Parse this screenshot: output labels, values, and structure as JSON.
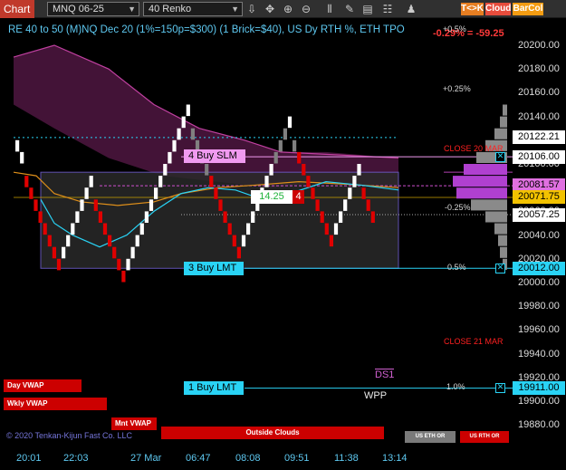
{
  "toolbar": {
    "chart_tab": "Chart",
    "instrument": "MNQ 06-25",
    "bar_type": "40 Renko",
    "tk_label": "T<>K",
    "cloud_label": "Cloud",
    "barcol_label": "BarCol",
    "icons": [
      "arrow-down-icon",
      "crosshair-icon",
      "zoom-in-icon",
      "zoom-out-icon",
      "bars-icon",
      "draw-icon",
      "properties-icon",
      "templates-icon",
      "strategies-icon"
    ],
    "colors": {
      "chart_tab": "#c0392b",
      "tk": "#e67e22",
      "cloud": "#e74c3c",
      "barcol": "#f39c12"
    }
  },
  "chart": {
    "title": "RE 40 to 50 (M)NQ Dec 20 (1%=150p=$300) (1 Brick=$40), US Dy RTH %, ETH TPO",
    "pct_change": "-0.29% = -59.25",
    "pct_levels": [
      "+0.5%",
      "+0.25%",
      "-0.25%",
      "0.5%",
      "1.0%"
    ],
    "close_labels": [
      "CLOSE 20 MAR",
      "CLOSE 21 MAR"
    ],
    "orders": {
      "buy_slm": "4 Buy SLM",
      "buy_lmt3": "3 Buy LMT",
      "buy_lmt1": "1 Buy LMT"
    },
    "position": {
      "pnl": "14.25",
      "qty": "4"
    },
    "ds1": "DS1",
    "wpp": "WPP",
    "copyright": "© 2020 Tenkan-Kijun Fast Co. LLC",
    "price_axis": [
      "20200.00",
      "20180.00",
      "20160.00",
      "20140.00",
      "20120.00",
      "20100.00",
      "20080.00",
      "20060.00",
      "20040.00",
      "20020.00",
      "20000.00",
      "19980.00",
      "19960.00",
      "19940.00",
      "19920.00",
      "19900.00",
      "19880.00"
    ],
    "price_boxes": {
      "b1": "20122.21",
      "b2": "20106.00",
      "b3": "20081.57",
      "b4": "20071.75",
      "b5": "20057.25",
      "b6": "20012.00",
      "b7": "19911.00"
    },
    "time_axis": [
      "20:01",
      "22:03",
      "27 Mar",
      "06:47",
      "08:08",
      "09:51",
      "11:38",
      "13:14"
    ],
    "indicators": {
      "day_vwap": "Day VWAP",
      "wkly_vwap": "Wkly VWAP",
      "mnt_vwap": "Mnt VWAP",
      "outside_clouds": "Outside Clouds",
      "us_eth": "US ETH OR",
      "us_rth": "US RTH OR"
    },
    "colors": {
      "up_brick": "#ffffff",
      "down_brick": "#e00000",
      "neutral_brick": "#808080",
      "cloud": "#5a1a4a",
      "cyan": "#29d3f5",
      "magenta": "#f09af0",
      "orange": "#e0901a"
    }
  },
  "chart_data": {
    "type": "renko",
    "brick_size": 10,
    "price_range": [
      19870,
      20210
    ],
    "bricks": [
      {
        "o": 20110,
        "d": 1
      },
      {
        "o": 20100,
        "d": 1
      },
      {
        "o": 20090,
        "d": -1
      },
      {
        "o": 20080,
        "d": -1
      },
      {
        "o": 20070,
        "d": -1
      },
      {
        "o": 20060,
        "d": -1
      },
      {
        "o": 20050,
        "d": -1
      },
      {
        "o": 20040,
        "d": -1
      },
      {
        "o": 20030,
        "d": -1
      },
      {
        "o": 20020,
        "d": -1
      },
      {
        "o": 20020,
        "d": 1
      },
      {
        "o": 20030,
        "d": 1
      },
      {
        "o": 20040,
        "d": 1
      },
      {
        "o": 20050,
        "d": 1
      },
      {
        "o": 20060,
        "d": 1
      },
      {
        "o": 20070,
        "d": 1
      },
      {
        "o": 20080,
        "d": 1
      },
      {
        "o": 20070,
        "d": -1
      },
      {
        "o": 20060,
        "d": -1
      },
      {
        "o": 20050,
        "d": -1
      },
      {
        "o": 20040,
        "d": -1
      },
      {
        "o": 20030,
        "d": -1
      },
      {
        "o": 20020,
        "d": -1
      },
      {
        "o": 20010,
        "d": -1
      },
      {
        "o": 20010,
        "d": 1
      },
      {
        "o": 20020,
        "d": 1
      },
      {
        "o": 20030,
        "d": 1
      },
      {
        "o": 20040,
        "d": 1
      },
      {
        "o": 20050,
        "d": 1
      },
      {
        "o": 20060,
        "d": 1
      },
      {
        "o": 20070,
        "d": 1
      },
      {
        "o": 20080,
        "d": 1
      },
      {
        "o": 20090,
        "d": 1
      },
      {
        "o": 20100,
        "d": 1
      },
      {
        "o": 20110,
        "d": 1
      },
      {
        "o": 20120,
        "d": 1
      },
      {
        "o": 20130,
        "d": 1
      },
      {
        "o": 20140,
        "d": 1
      },
      {
        "o": 20130,
        "d": -1
      },
      {
        "o": 20120,
        "d": -1
      },
      {
        "o": 20110,
        "d": -1
      },
      {
        "o": 20100,
        "d": -1
      },
      {
        "o": 20090,
        "d": -1
      },
      {
        "o": 20080,
        "d": -1
      },
      {
        "o": 20070,
        "d": -1
      },
      {
        "o": 20060,
        "d": -1
      },
      {
        "o": 20050,
        "d": -1
      },
      {
        "o": 20040,
        "d": -1
      },
      {
        "o": 20030,
        "d": -1
      },
      {
        "o": 20030,
        "d": 1
      },
      {
        "o": 20040,
        "d": 1
      },
      {
        "o": 20050,
        "d": 1
      },
      {
        "o": 20060,
        "d": 1
      },
      {
        "o": 20070,
        "d": 1
      },
      {
        "o": 20080,
        "d": 1
      },
      {
        "o": 20090,
        "d": 1
      },
      {
        "o": 20100,
        "d": 1
      },
      {
        "o": 20110,
        "d": 1
      },
      {
        "o": 20120,
        "d": 1
      },
      {
        "o": 20130,
        "d": 1
      },
      {
        "o": 20120,
        "d": -1
      },
      {
        "o": 20110,
        "d": -1
      },
      {
        "o": 20100,
        "d": -1
      },
      {
        "o": 20090,
        "d": -1
      },
      {
        "o": 20080,
        "d": -1
      },
      {
        "o": 20070,
        "d": -1
      },
      {
        "o": 20060,
        "d": -1
      },
      {
        "o": 20050,
        "d": -1
      },
      {
        "o": 20040,
        "d": -1
      },
      {
        "o": 20040,
        "d": 1
      },
      {
        "o": 20050,
        "d": 1
      },
      {
        "o": 20060,
        "d": 1
      },
      {
        "o": 20070,
        "d": 1
      },
      {
        "o": 20080,
        "d": 1
      },
      {
        "o": 20090,
        "d": 1
      },
      {
        "o": 20080,
        "d": -1
      },
      {
        "o": 20070,
        "d": -1
      },
      {
        "o": 20060,
        "d": -1
      }
    ]
  }
}
